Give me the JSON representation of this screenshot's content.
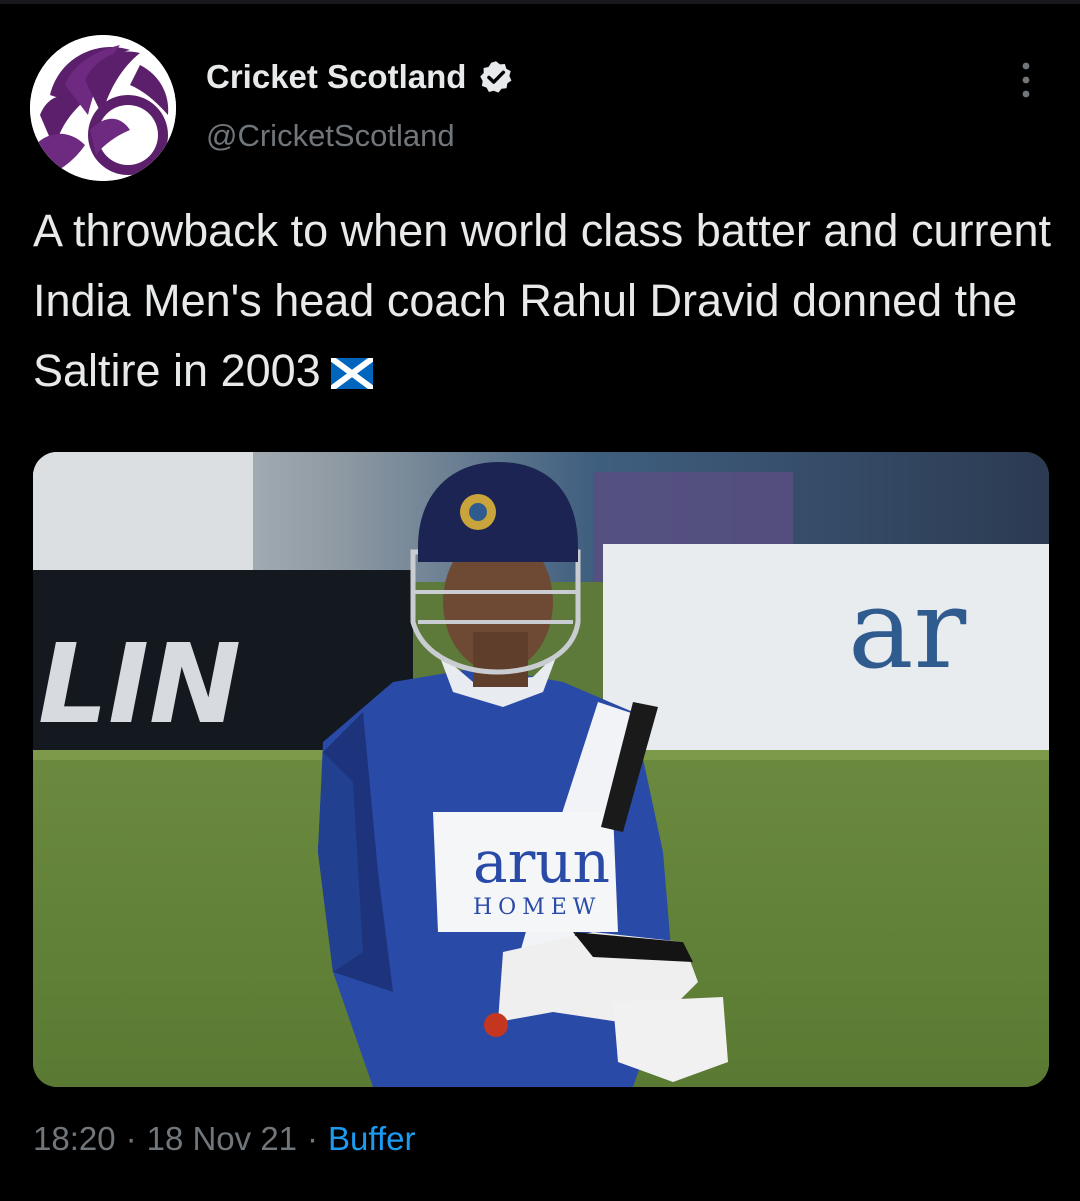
{
  "account": {
    "display_name": "Cricket Scotland",
    "handle": "@CricketScotland",
    "verified": true,
    "avatar_icon": "cricket-scotland-logo"
  },
  "tweet": {
    "text": "A throwback to when world class batter and current India Men's head coach Rahul Dravid donned the Saltire in 2003",
    "emoji_icon": "scotland-flag-icon",
    "media_alt": "photo"
  },
  "meta": {
    "time": "18:20",
    "date": "18 Nov 21",
    "separator": "·",
    "source": "Buffer"
  },
  "photo_text": {
    "board_left": "LIN",
    "board_right": "ar",
    "shirt_sponsor": "arun",
    "shirt_sponsor_sub": "HOMEW"
  },
  "colors": {
    "background": "#000000",
    "text_primary": "#e7e9ea",
    "text_secondary": "#71767b",
    "link": "#1d9bf0",
    "brand_purple": "#5b1f6b"
  }
}
